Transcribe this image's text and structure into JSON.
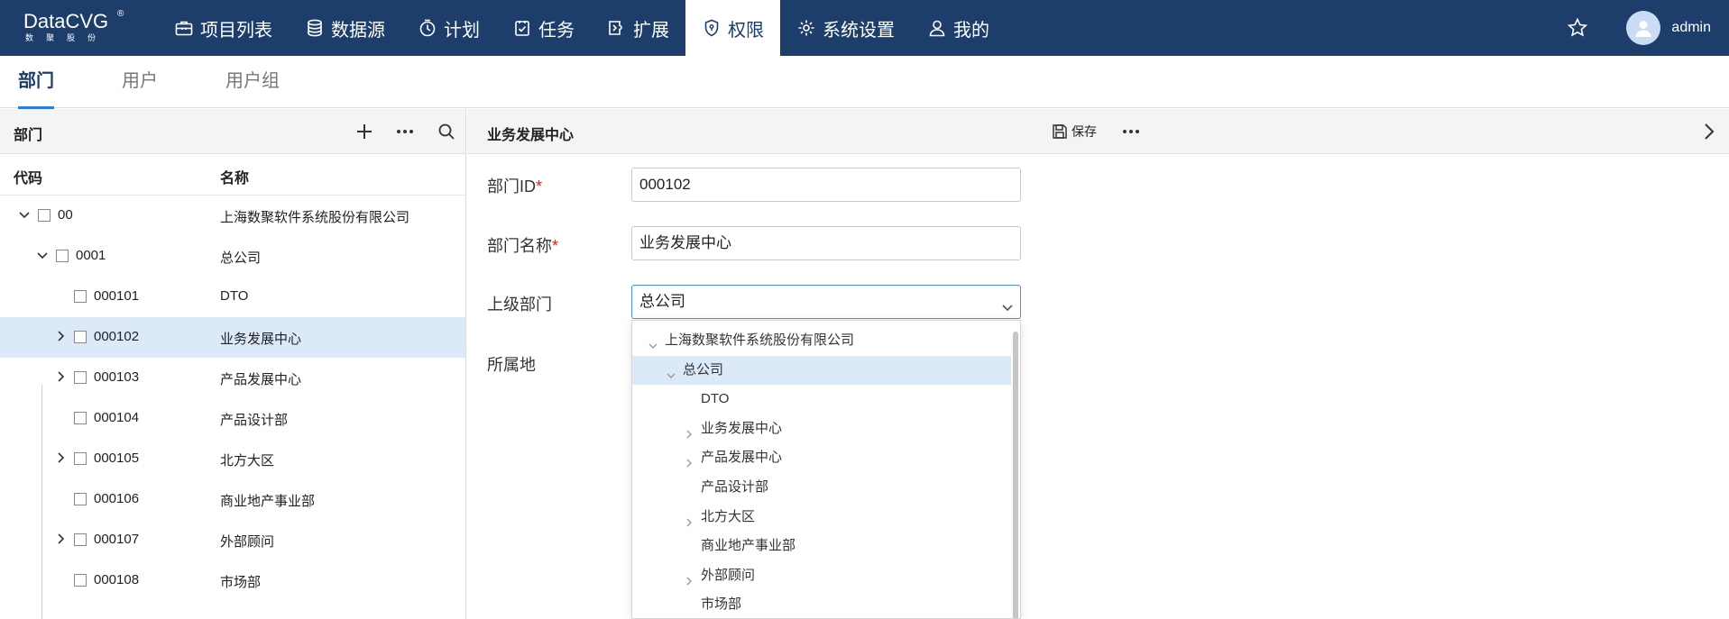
{
  "brand": {
    "name": "DataCVG",
    "registered": "®",
    "subtitle": "数聚股份"
  },
  "nav": [
    {
      "label": "项目列表",
      "icon": "toolbox-icon"
    },
    {
      "label": "数据源",
      "icon": "database-icon"
    },
    {
      "label": "计划",
      "icon": "clock-icon"
    },
    {
      "label": "任务",
      "icon": "task-icon"
    },
    {
      "label": "扩展",
      "icon": "extension-icon"
    },
    {
      "label": "权限",
      "icon": "shield-icon",
      "active": true
    },
    {
      "label": "系统设置",
      "icon": "gear-icon"
    },
    {
      "label": "我的",
      "icon": "user-icon"
    }
  ],
  "user": {
    "name": "admin"
  },
  "subtabs": [
    "部门",
    "用户",
    "用户组"
  ],
  "left": {
    "title": "部门",
    "columns": {
      "code": "代码",
      "name": "名称"
    },
    "rows": [
      {
        "code": "00",
        "name": "上海数聚软件系统股份有限公司",
        "caret": "down",
        "level": 0
      },
      {
        "code": "0001",
        "name": "总公司",
        "caret": "down",
        "level": 1
      },
      {
        "code": "000101",
        "name": "DTO",
        "caret": "",
        "level": 2
      },
      {
        "code": "000102",
        "name": "业务发展中心",
        "caret": "right",
        "level": 2,
        "selected": true
      },
      {
        "code": "000103",
        "name": "产品发展中心",
        "caret": "right",
        "level": 2
      },
      {
        "code": "000104",
        "name": "产品设计部",
        "caret": "",
        "level": 2
      },
      {
        "code": "000105",
        "name": "北方大区",
        "caret": "right",
        "level": 2
      },
      {
        "code": "000106",
        "name": "商业地产事业部",
        "caret": "",
        "level": 2
      },
      {
        "code": "000107",
        "name": "外部顾问",
        "caret": "right",
        "level": 2
      },
      {
        "code": "000108",
        "name": "市场部",
        "caret": "",
        "level": 2
      }
    ]
  },
  "right": {
    "title": "业务发展中心",
    "save_label": "保存",
    "fields": {
      "id_label": "部门ID",
      "id_value": "000102",
      "name_label": "部门名称",
      "name_value": "业务发展中心",
      "parent_label": "上级部门",
      "parent_value": "总公司",
      "location_label": "所属地"
    },
    "dropdown": [
      {
        "text": "上海数聚软件系统股份有限公司",
        "caret": "down",
        "level": 0
      },
      {
        "text": "总公司",
        "caret": "down",
        "level": 1,
        "selected": true
      },
      {
        "text": "DTO",
        "caret": "",
        "level": 2
      },
      {
        "text": "业务发展中心",
        "caret": "right",
        "level": 2
      },
      {
        "text": "产品发展中心",
        "caret": "right",
        "level": 2
      },
      {
        "text": "产品设计部",
        "caret": "",
        "level": 2
      },
      {
        "text": "北方大区",
        "caret": "right",
        "level": 2
      },
      {
        "text": "商业地产事业部",
        "caret": "",
        "level": 2
      },
      {
        "text": "外部顾问",
        "caret": "right",
        "level": 2
      },
      {
        "text": "市场部",
        "caret": "",
        "level": 2
      }
    ]
  }
}
